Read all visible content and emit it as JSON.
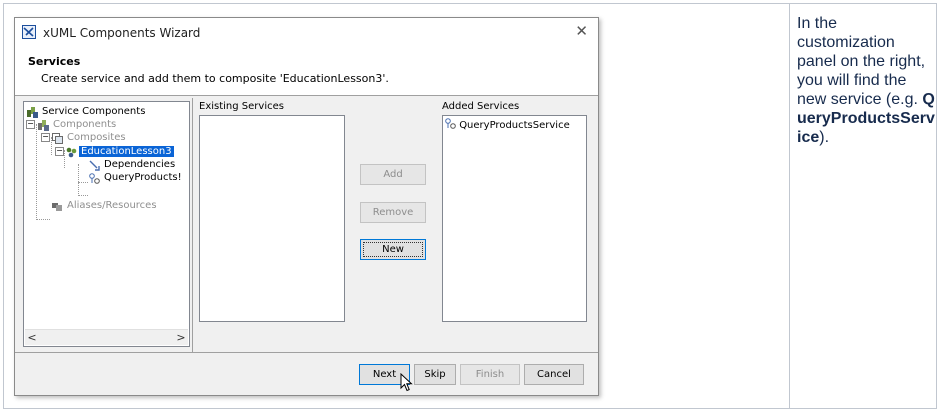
{
  "dialog": {
    "title": "xUML Components Wizard",
    "close_symbol": "✕",
    "header_title": "Services",
    "header_subtitle": "Create service and add them to composite 'EducationLesson3'."
  },
  "tree": {
    "items": [
      {
        "label": "Service Components",
        "icon": "service-components-icon",
        "state": "normal"
      },
      {
        "label": "Components",
        "icon": "components-icon",
        "state": "disabled"
      },
      {
        "label": "Composites",
        "icon": "composites-icon",
        "state": "disabled"
      },
      {
        "label": "EducationLesson3",
        "icon": "composite-icon",
        "state": "selected"
      },
      {
        "label": "Dependencies",
        "icon": "dependencies-icon",
        "state": "normal"
      },
      {
        "label": "QueryProducts!",
        "icon": "service-icon",
        "state": "normal"
      },
      {
        "label": "Aliases/Resources",
        "icon": "aliases-icon",
        "state": "disabled"
      }
    ],
    "scroll_left": "<",
    "scroll_right": ">"
  },
  "existing_services": {
    "label": "Existing Services",
    "items": []
  },
  "added_services": {
    "label": "Added Services",
    "items": [
      {
        "label": "QueryProductsService",
        "icon": "service-icon"
      }
    ]
  },
  "buttons": {
    "add": "Add",
    "remove": "Remove",
    "new": "New",
    "next": "Next",
    "skip": "Skip",
    "finish": "Finish",
    "cancel": "Cancel"
  },
  "doc": {
    "text_before": "In the customization panel on the right, you will find the new service (e.g. ",
    "bold": "QueryProductsService",
    "text_after": ")."
  },
  "colors": {
    "selection": "#0a64d6",
    "accent": "#0078d7",
    "disabled_text": "#8f8f8f"
  }
}
